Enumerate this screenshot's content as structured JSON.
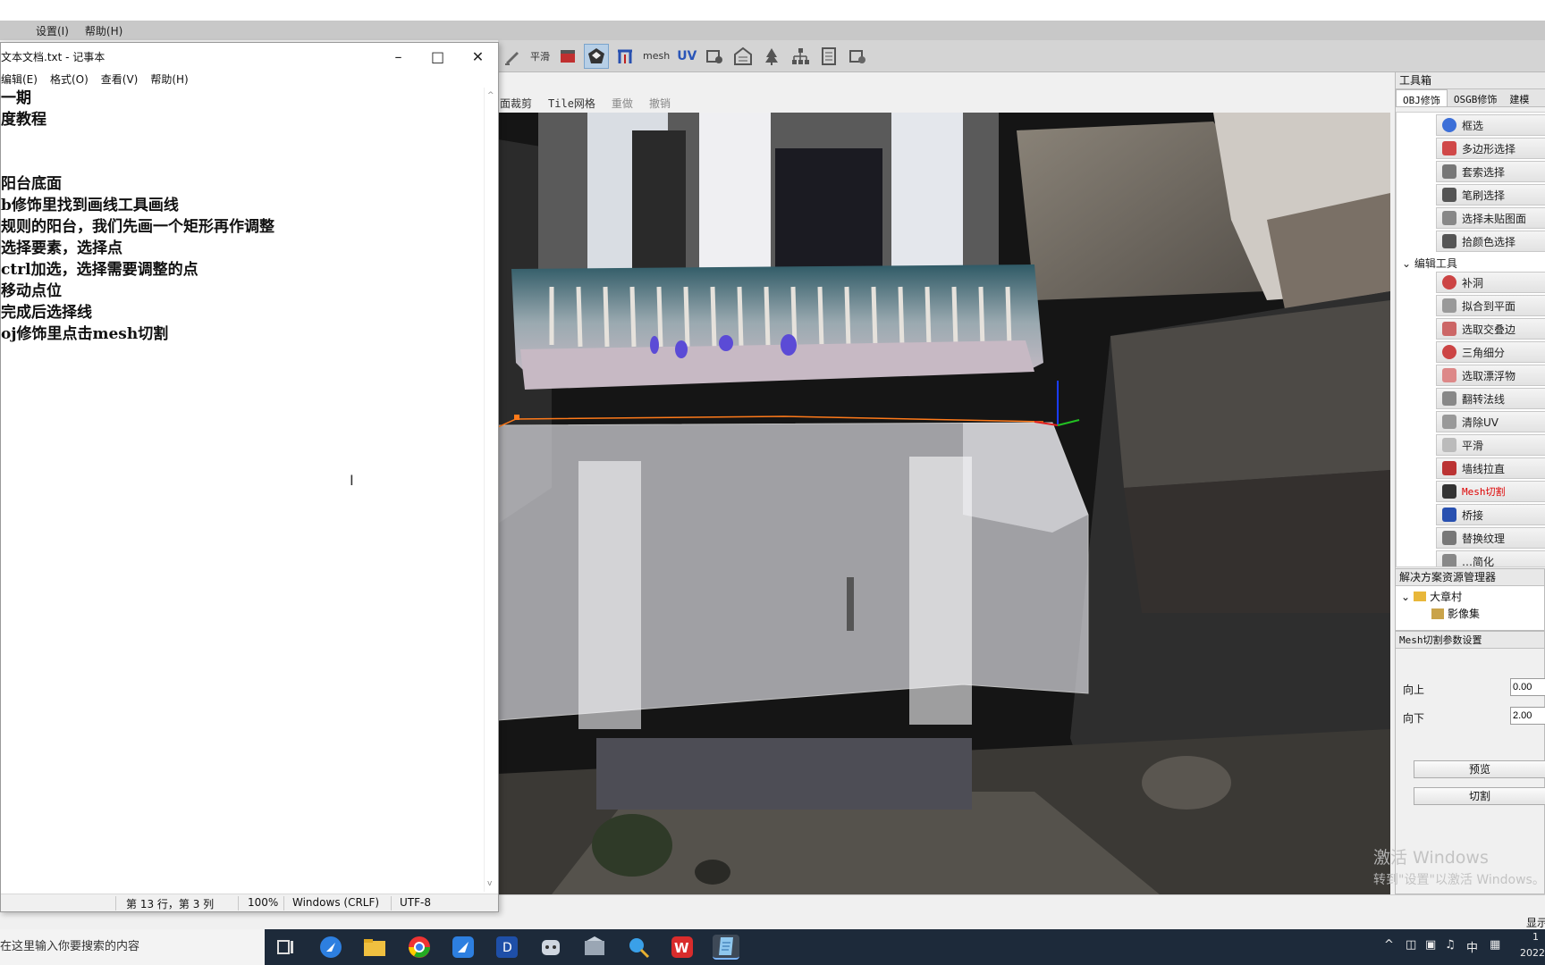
{
  "app": {
    "menu": [
      "",
      "设置(I)",
      "帮助(H)"
    ],
    "toolbar": {
      "smooth_label": "平滑",
      "mesh_label": "mesh",
      "uv_label": "UV"
    },
    "viewport_toolbar": [
      "面裁剪",
      "Tile网格",
      "重做",
      "撤销"
    ],
    "corner_label": "显示",
    "toolbox": {
      "title": "工具箱",
      "tabs": [
        "OBJ修饰",
        "OSGB修饰",
        "建模"
      ],
      "select_tools": [
        "框选",
        "多边形选择",
        "套索选择",
        "笔刷选择",
        "选择未贴图面",
        "拾颜色选择"
      ],
      "edit_group": "编辑工具",
      "edit_tools": [
        "补洞",
        "拟合到平面",
        "选取交叠边",
        "三角细分",
        "选取漂浮物",
        "翻转法线",
        "清除UV",
        "平滑",
        "墙线拉直",
        "Mesh切割",
        "桥接",
        "替换纹理",
        "…简化"
      ]
    },
    "solution": {
      "title": "解决方案资源管理器",
      "root": "大章村",
      "child": "影像集"
    },
    "mesh_cut": {
      "title": "Mesh切割参数设置",
      "up_label": "向上",
      "up_value": "0.00",
      "down_label": "向下",
      "down_value": "2.00",
      "preview": "预览",
      "cut": "切割"
    },
    "watermark": {
      "line1": "激活 Windows",
      "line2": "转到\"设置\"以激活 Windows。"
    }
  },
  "notepad": {
    "title": "文本文档.txt - 记事本",
    "menu": [
      "编辑(E)",
      "格式(O)",
      "查看(V)",
      "帮助(H)"
    ],
    "lines": [
      "一期",
      "度教程",
      "",
      "",
      "阳台底面",
      "b修饰里找到画线工具画线",
      "规则的阳台，我们先画一个矩形再作调整",
      "选择要素，选择点",
      "ctrl加选，选择需要调整的点",
      "移动点位",
      "完成后选择线",
      "oj修饰里点击mesh切割"
    ],
    "status": {
      "pos": "第 13 行，第 3 列",
      "zoom": "100%",
      "eol": "Windows (CRLF)",
      "enc": "UTF-8"
    }
  },
  "taskbar": {
    "search": "在这里输入你要搜索的内容",
    "ime": "中",
    "time_partial": "1",
    "date_partial": "2022"
  }
}
